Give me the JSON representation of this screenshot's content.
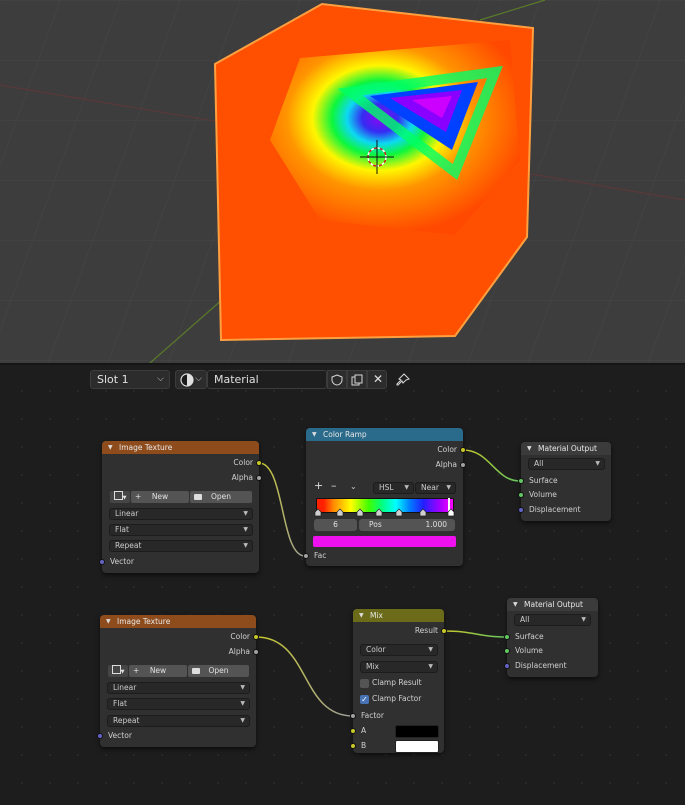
{
  "header": {
    "slot_label": "Slot 1",
    "material_name": "Material"
  },
  "nodes": {
    "image_texture_1": {
      "title": "Image Texture",
      "outputs": [
        "Color",
        "Alpha"
      ],
      "new_label": "New",
      "open_label": "Open",
      "interpolation": "Linear",
      "projection": "Flat",
      "extension": "Repeat",
      "input": "Vector"
    },
    "color_ramp": {
      "title": "Color Ramp",
      "outputs": [
        "Color",
        "Alpha"
      ],
      "color_mode": "HSL",
      "interpolation": "Near",
      "stop_index": "6",
      "pos_label": "Pos",
      "pos_value": "1.000",
      "input": "Fac",
      "stop_color": "#ee10ee"
    },
    "material_output_1": {
      "title": "Material Output",
      "target": "All",
      "inputs": [
        "Surface",
        "Volume",
        "Displacement"
      ]
    },
    "image_texture_2": {
      "title": "Image Texture",
      "outputs": [
        "Color",
        "Alpha"
      ],
      "new_label": "New",
      "open_label": "Open",
      "interpolation": "Linear",
      "projection": "Flat",
      "extension": "Repeat",
      "input": "Vector"
    },
    "mix": {
      "title": "Mix",
      "output": "Result",
      "data_type": "Color",
      "blend_mode": "Mix",
      "clamp_result_label": "Clamp Result",
      "clamp_result": false,
      "clamp_factor_label": "Clamp Factor",
      "clamp_factor": true,
      "inputs": [
        "Factor",
        "A",
        "B"
      ],
      "a_color": "#000000",
      "b_color": "#ffffff"
    },
    "material_output_2": {
      "title": "Material Output",
      "target": "All",
      "inputs": [
        "Surface",
        "Volume",
        "Displacement"
      ]
    }
  },
  "colors": {
    "texture_header": "#8e4c1c",
    "converter_header": "#2a6a8a",
    "output_header": "#3b3b3b",
    "mix_header": "#6b6b1a",
    "socket_color": "#c7c729",
    "socket_gray": "#a1a1a1",
    "socket_shader": "#63c763",
    "socket_vector": "#6363c7"
  }
}
